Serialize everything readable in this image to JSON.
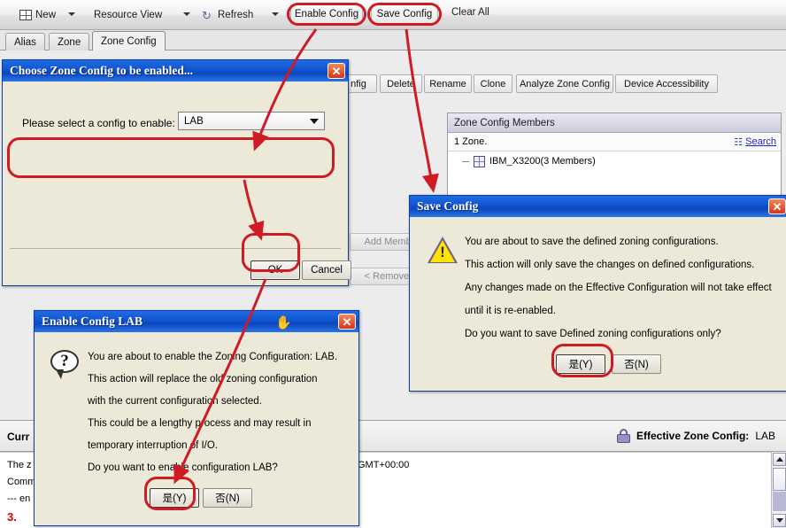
{
  "toolbar": {
    "new_label": "New",
    "resource_view_label": "Resource View",
    "refresh_label": "Refresh",
    "enable_config_label": "Enable Config",
    "save_config_label": "Save Config",
    "clear_all_label": "Clear All"
  },
  "tabs": [
    {
      "label": "Alias",
      "active": false
    },
    {
      "label": "Zone",
      "active": false
    },
    {
      "label": "Zone Config",
      "active": true
    }
  ],
  "action_buttons": {
    "config_partial": "nfig",
    "delete": "Delete",
    "rename": "Rename",
    "clone": "Clone",
    "analyze": "Analyze Zone Config",
    "device_accessibility": "Device Accessibility"
  },
  "member_buttons": {
    "add": "Add Member",
    "remove": "< Remove M"
  },
  "zone_config_members": {
    "panel_title": "Zone Config Members",
    "count_label": "1 Zone.",
    "search_label": "Search",
    "rows": [
      {
        "label": "IBM_X3200(3 Members)"
      }
    ]
  },
  "status_bar": {
    "left_label": "Curr",
    "effective_label": "Effective Zone Config:",
    "effective_value": "LAB"
  },
  "log": {
    "lines": [
      {
        "text": "The z",
        "red": false
      },
      {
        "text": "Comm",
        "red": false
      },
      {
        "text": "--- en",
        "red": false
      },
      {
        "text": "3.",
        "red": true
      }
    ],
    "timestamp": "GMT+00:00"
  },
  "dialog_choose": {
    "title": "Choose Zone Config to be enabled...",
    "prompt": "Please select a config to enable:",
    "selected_value": "LAB",
    "ok_label": "OK",
    "cancel_label": "Cancel",
    "close_glyph": "✕"
  },
  "dialog_enable": {
    "title": "Enable Config LAB",
    "icon": "question-icon",
    "lines": [
      "You are about to enable the Zoning Configuration: LAB.",
      "This action will replace the old zoning configuration",
      "with the current configuration selected.",
      "This could be a lengthy process and may result in",
      "temporary interruption of I/O.",
      "Do you want to enable configuration LAB?"
    ],
    "yes_label": "是(Y)",
    "no_label": "否(N)",
    "close_glyph": "✕"
  },
  "dialog_save": {
    "title": "Save Config",
    "icon": "warning-icon",
    "lines": [
      "You are about to save the defined zoning configurations.",
      "This action will only save the changes on defined configurations.",
      "Any changes made on the Effective Configuration will not take effect",
      "until it is re-enabled.",
      "Do you want to save Defined zoning configurations only?"
    ],
    "yes_label": "是(Y)",
    "no_label": "否(N)",
    "close_glyph": "✕"
  },
  "annotation": {
    "color": "#cf1b24"
  }
}
